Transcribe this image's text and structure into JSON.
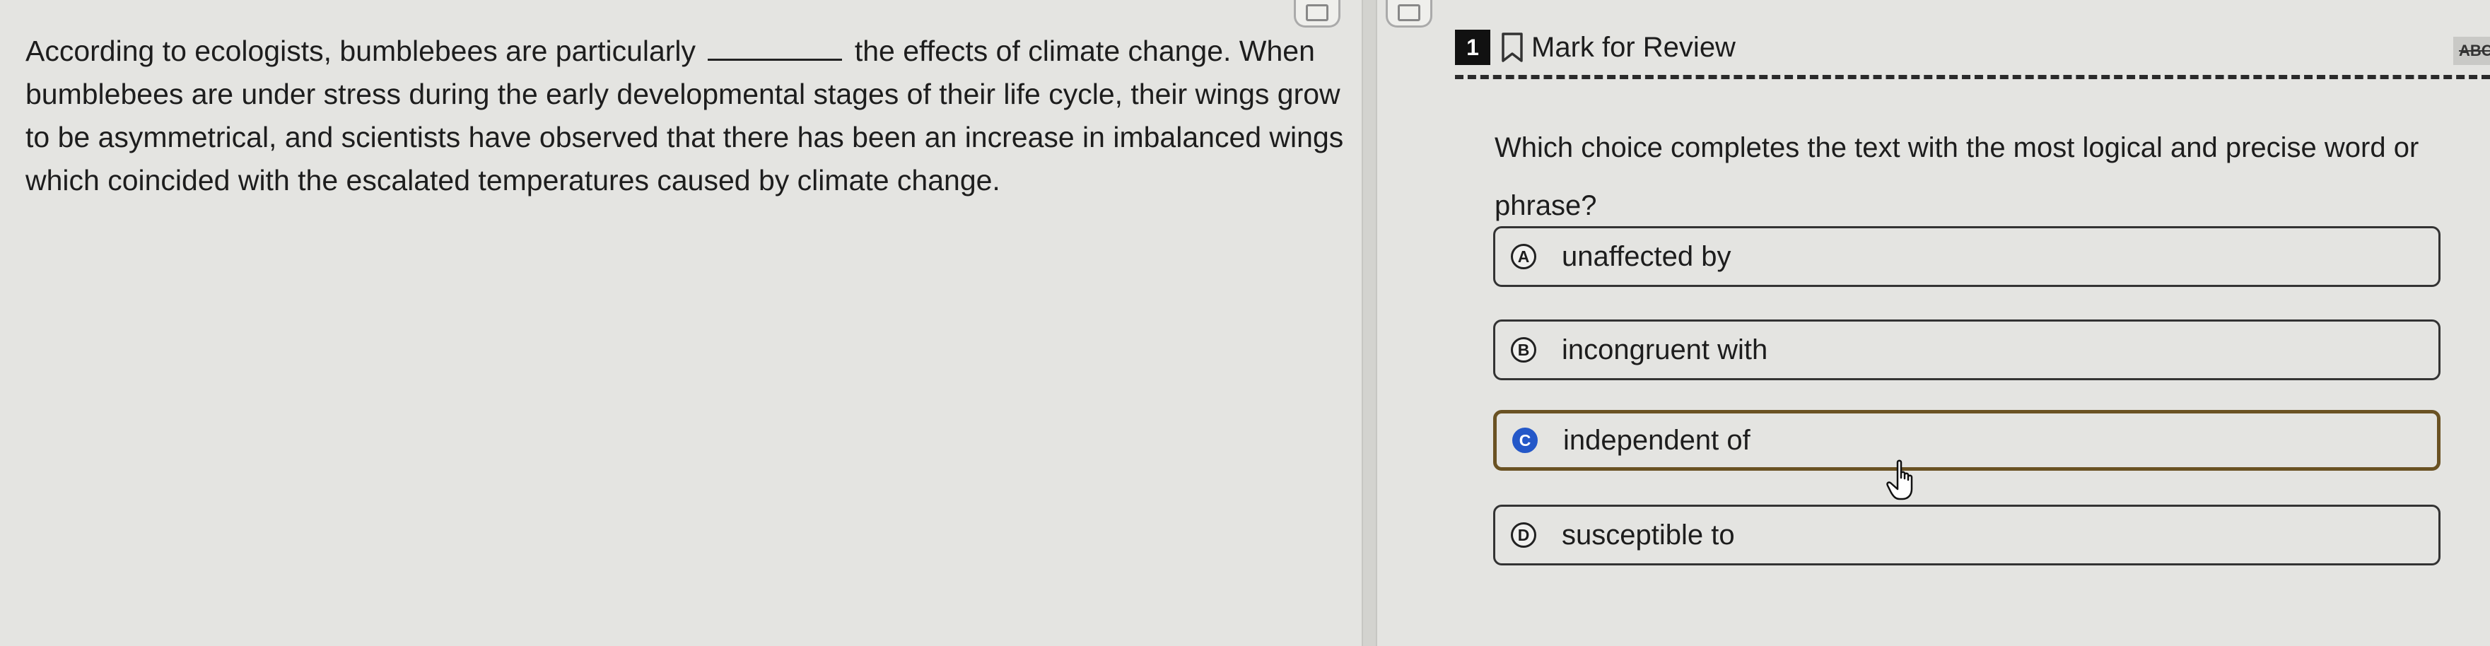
{
  "passage": {
    "before_blank": "According to ecologists, bumblebees are particularly",
    "after_blank": "the effects of climate change. When bumblebees are under stress during the early developmental stages of their life cycle, their wings grow to be asymmetrical, and scientists have observed that there has been an increase in imbalanced wings which coincided with the escalated temperatures caused by climate change."
  },
  "question": {
    "number": "1",
    "mark_label": "Mark for Review",
    "abc_tool": "ABC",
    "prompt": "Which choice completes the text with the most logical and precise word or phrase?",
    "choices": [
      {
        "letter": "A",
        "text": "unaffected by"
      },
      {
        "letter": "B",
        "text": "incongruent with"
      },
      {
        "letter": "C",
        "text": "independent of"
      },
      {
        "letter": "D",
        "text": "susceptible to"
      }
    ],
    "selected": "C"
  },
  "colors": {
    "selected_border": "#6a5223",
    "selected_letter_bg": "#2458c8"
  },
  "icons": [
    "bookmark-icon",
    "pane-handle-icon",
    "hand-cursor-icon"
  ]
}
